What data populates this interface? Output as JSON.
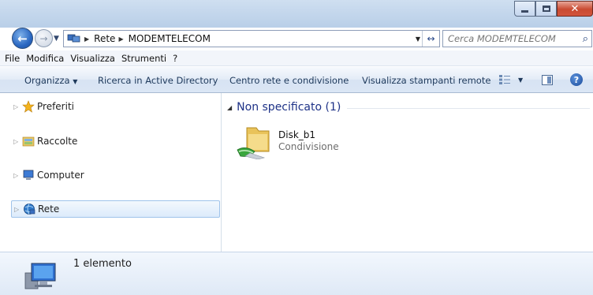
{
  "address": {
    "crumbs": [
      "Rete",
      "MODEMTELECOM"
    ]
  },
  "search": {
    "placeholder": "Cerca MODEMTELECOM"
  },
  "menu": [
    "File",
    "Modifica",
    "Visualizza",
    "Strumenti",
    "?"
  ],
  "commands": {
    "organize": "Organizza",
    "ad_search": "Ricerca in Active Directory",
    "network_center": "Centro rete e condivisione",
    "remote_printers": "Visualizza stampanti remote"
  },
  "nav": {
    "favorites": "Preferiti",
    "libraries": "Raccolte",
    "computer": "Computer",
    "network": "Rete"
  },
  "group": {
    "label": "Non specificato (1)"
  },
  "items": [
    {
      "name": "Disk_b1",
      "type": "Condivisione"
    }
  ],
  "status": {
    "count": "1 elemento"
  },
  "colors": {
    "accent": "#1e3287",
    "selection": "#dcebfb",
    "close": "#c94a31"
  }
}
